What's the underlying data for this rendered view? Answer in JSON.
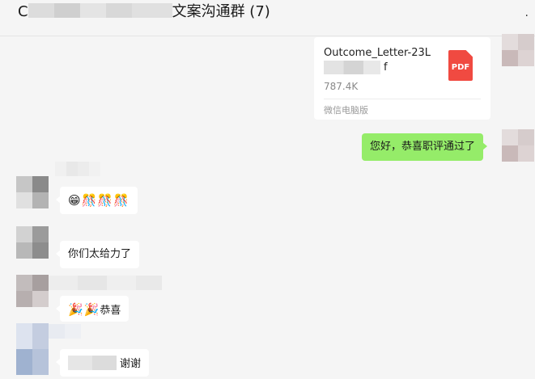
{
  "header": {
    "title_prefix": "C",
    "title_suffix": "文案沟通群 (7)",
    "more": "·"
  },
  "file_message": {
    "name_line1": "Outcome_Letter-23L",
    "name_ext": "f",
    "size": "787.4K",
    "icon_label": "PDF",
    "source": "微信电脑版"
  },
  "messages": {
    "me_congrats": "您好，恭喜职评通过了",
    "reply1_emoji": "😁🎊🎊🎊",
    "reply2_text": "你们太给力了",
    "reply3_emoji": "🎉🎉",
    "reply3_text": "恭喜",
    "reply4_text": "谢谢"
  },
  "colors": {
    "background": "#f5f5f5",
    "my_bubble": "#95ec69",
    "other_bubble": "#ffffff",
    "pdf_red": "#f04a41"
  }
}
